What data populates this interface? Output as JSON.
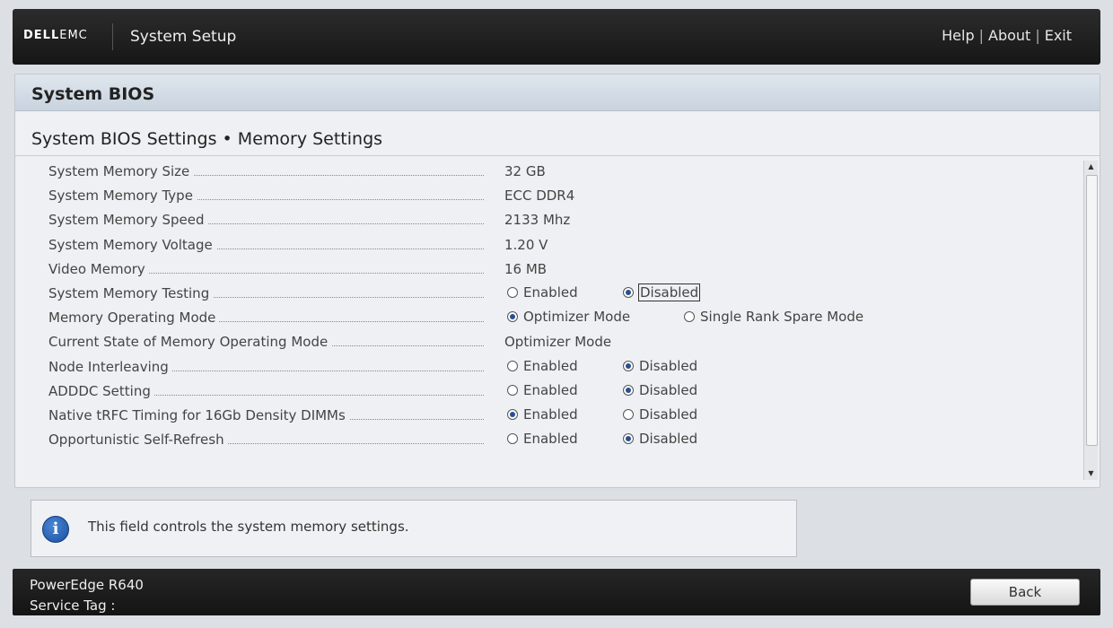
{
  "header": {
    "logo_dell": "DELL",
    "logo_emc": "EMC",
    "title": "System Setup",
    "links": [
      "Help",
      "About",
      "Exit"
    ],
    "link_separator": "|"
  },
  "panel": {
    "title": "System BIOS",
    "breadcrumb": "System BIOS Settings • Memory Settings"
  },
  "settings": [
    {
      "label": "System Memory Size",
      "value": "32 GB"
    },
    {
      "label": "System Memory Type",
      "value": "ECC DDR4"
    },
    {
      "label": "System Memory Speed",
      "value": "2133 Mhz"
    },
    {
      "label": "System Memory Voltage",
      "value": "1.20 V"
    },
    {
      "label": "Video Memory",
      "value": "16 MB"
    },
    {
      "label": "System Memory Testing",
      "options": [
        "Enabled",
        "Disabled"
      ],
      "selected": 1
    },
    {
      "label": "Memory Operating Mode",
      "options": [
        "Optimizer Mode",
        "Single Rank Spare Mode"
      ],
      "selected": 0
    },
    {
      "label": "Current State of Memory Operating Mode",
      "value": "Optimizer Mode"
    },
    {
      "label": "Node Interleaving",
      "options": [
        "Enabled",
        "Disabled"
      ],
      "selected": 1
    },
    {
      "label": "ADDDC Setting",
      "options": [
        "Enabled",
        "Disabled"
      ],
      "selected": 1
    },
    {
      "label": "Native tRFC Timing for 16Gb Density DIMMs",
      "options": [
        "Enabled",
        "Disabled"
      ],
      "selected": 0
    },
    {
      "label": "Opportunistic Self-Refresh",
      "options": [
        "Enabled",
        "Disabled"
      ],
      "selected": 1
    }
  ],
  "help": {
    "icon": "info-icon",
    "text": "This field controls the system memory settings."
  },
  "footer": {
    "model": "PowerEdge R640",
    "service_tag_label": "Service Tag :",
    "back_label": "Back"
  },
  "colors": {
    "header_bg": "#1e1e1e",
    "panel_bg": "#eef0f3",
    "radio_selected": "#2a4f8f"
  }
}
